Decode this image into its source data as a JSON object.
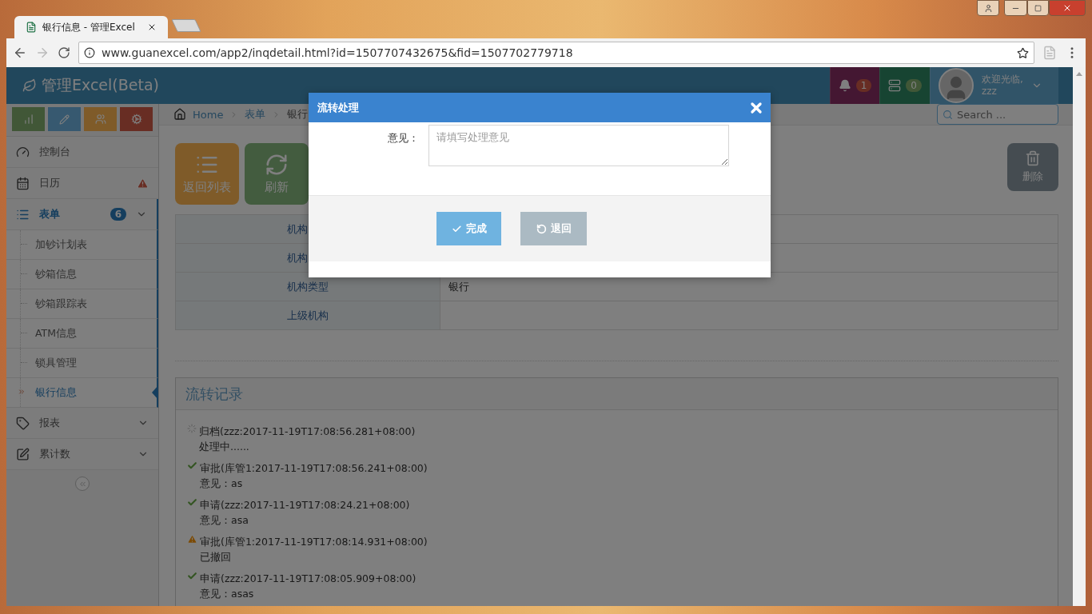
{
  "browser": {
    "tab_title": "银行信息 - 管理Excel",
    "url": "www.guanexcel.com/app2/inqdetail.html?id=1507707432675&fid=1507702779718"
  },
  "header": {
    "brand": "管理Excel(Beta)",
    "notifications": "1",
    "messages": "0",
    "welcome": "欢迎光临,",
    "user": "zzz"
  },
  "sidebar": {
    "items": [
      {
        "label": "控制台",
        "selected": false
      },
      {
        "label": "日历",
        "selected": false,
        "alert": true
      },
      {
        "label": "表单",
        "selected": true,
        "badge": "6",
        "chevron": true,
        "children": [
          {
            "label": "加钞计划表",
            "selected": false
          },
          {
            "label": "钞箱信息",
            "selected": false
          },
          {
            "label": "钞箱跟踪表",
            "selected": false
          },
          {
            "label": "ATM信息",
            "selected": false
          },
          {
            "label": "锁具管理",
            "selected": false
          },
          {
            "label": "银行信息",
            "selected": true
          }
        ]
      },
      {
        "label": "报表",
        "selected": false,
        "chevron": true
      },
      {
        "label": "累计数",
        "selected": false,
        "chevron": true
      }
    ]
  },
  "breadcrumb": [
    "Home",
    "表单",
    "银行"
  ],
  "search": {
    "placeholder": "Search ..."
  },
  "actions": [
    {
      "label": "返回列表",
      "kind": "list"
    },
    {
      "label": "刷新",
      "kind": "refresh"
    }
  ],
  "delete_button": "删除",
  "table": {
    "rows": [
      {
        "label": "机构"
      },
      {
        "label": "机构"
      },
      {
        "label": "机构类型",
        "value": "银行"
      },
      {
        "label": "上级机构"
      }
    ]
  },
  "log": {
    "title": "流转记录",
    "entries": [
      {
        "kind": "pending",
        "title": "归档(zzz:2017-11-19T17:08:56.281+08:00)",
        "detail": "处理中......"
      },
      {
        "kind": "done",
        "title": "审批(库管1:2017-11-19T17:08:56.241+08:00)",
        "detail": "意见：as"
      },
      {
        "kind": "done",
        "title": "申请(zzz:2017-11-19T17:08:24.21+08:00)",
        "detail": "意见：asa"
      },
      {
        "kind": "warning",
        "title": "审批(库管1:2017-11-19T17:08:14.931+08:00)",
        "detail": "已撤回"
      },
      {
        "kind": "done",
        "title": "申请(zzz:2017-11-19T17:08:05.909+08:00)",
        "detail": "意见：asas"
      }
    ]
  },
  "dialog": {
    "title": "流转处理",
    "field_label": "意见：",
    "placeholder": "请填写处理意见",
    "buttons": [
      {
        "label": "完成",
        "kind": "confirm"
      },
      {
        "label": "退回",
        "kind": "reject"
      }
    ]
  }
}
